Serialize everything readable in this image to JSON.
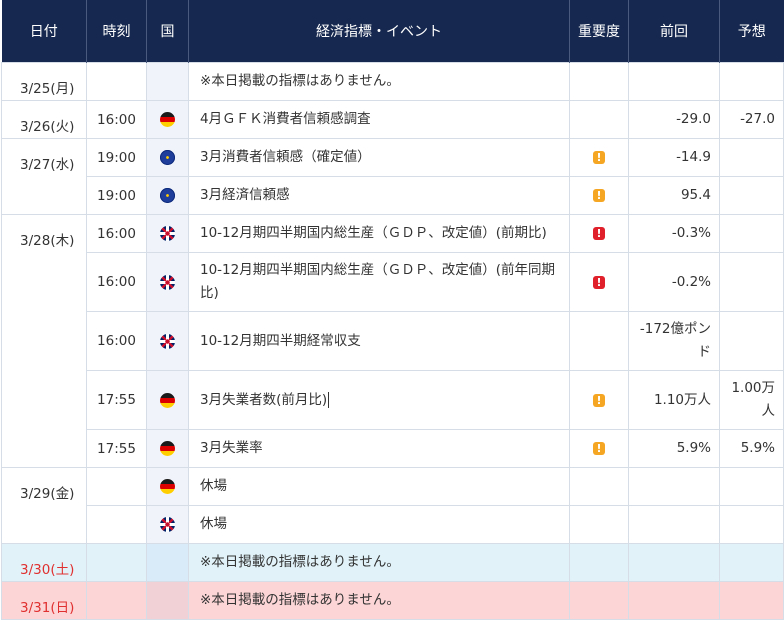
{
  "header": {
    "date": "日付",
    "time": "時刻",
    "country": "国",
    "event": "経済指標・イベント",
    "importance": "重要度",
    "previous": "前回",
    "forecast": "予想"
  },
  "rows": [
    {
      "date": "3/25(月)",
      "time": "",
      "flag": "",
      "event": "※本日掲載の指標はありません。",
      "importance": "",
      "previous": "",
      "forecast": ""
    },
    {
      "date": "3/26(火)",
      "time": "16:00",
      "flag": "germany-flag-icon",
      "event": "4月ＧＦＫ消費者信頼感調査",
      "importance": "",
      "previous": "-29.0",
      "forecast": "-27.0"
    },
    {
      "date": "3/27(水)",
      "time": "19:00",
      "flag": "eu-flag-icon",
      "event": "3月消費者信頼感（確定値）",
      "importance": "medium",
      "previous": "-14.9",
      "forecast": ""
    },
    {
      "date": "",
      "time": "19:00",
      "flag": "eu-flag-icon",
      "event": "3月経済信頼感",
      "importance": "medium",
      "previous": "95.4",
      "forecast": ""
    },
    {
      "date": "3/28(木)",
      "time": "16:00",
      "flag": "uk-flag-icon",
      "event": "10-12月期四半期国内総生産（ＧＤＰ、改定値）(前期比)",
      "importance": "high",
      "previous": "-0.3%",
      "forecast": ""
    },
    {
      "date": "",
      "time": "16:00",
      "flag": "uk-flag-icon",
      "event": "10-12月期四半期国内総生産（ＧＤＰ、改定値）(前年同期比)",
      "importance": "high",
      "previous": "-0.2%",
      "forecast": ""
    },
    {
      "date": "",
      "time": "16:00",
      "flag": "uk-flag-icon",
      "event": "10-12月期四半期経常収支",
      "importance": "",
      "previous": "-172億ポンド",
      "forecast": ""
    },
    {
      "date": "",
      "time": "17:55",
      "flag": "germany-flag-icon",
      "event": "3月失業者数(前月比)",
      "importance": "medium",
      "previous": "1.10万人",
      "forecast": "1.00万人"
    },
    {
      "date": "",
      "time": "17:55",
      "flag": "germany-flag-icon",
      "event": "3月失業率",
      "importance": "medium",
      "previous": "5.9%",
      "forecast": "5.9%"
    },
    {
      "date": "3/29(金)",
      "time": "",
      "flag": "germany-flag-icon",
      "event": "休場",
      "importance": "",
      "previous": "",
      "forecast": ""
    },
    {
      "date": "",
      "time": "",
      "flag": "uk-flag-icon",
      "event": "休場",
      "importance": "",
      "previous": "",
      "forecast": ""
    },
    {
      "date": "3/30(土)",
      "time": "",
      "flag": "",
      "event": "※本日掲載の指標はありません。",
      "importance": "",
      "previous": "",
      "forecast": ""
    },
    {
      "date": "3/31(日)",
      "time": "",
      "flag": "",
      "event": "※本日掲載の指標はありません。",
      "importance": "",
      "previous": "",
      "forecast": ""
    }
  ],
  "importance_badge": "!",
  "colors": {
    "header_bg": "#16284f",
    "weekend_sat_bg": "#e1f3f9",
    "weekend_sun_bg": "#fcd5d6",
    "weekend_date_text": "#e03030",
    "importance_medium": "#f5a623",
    "importance_high": "#e0202a"
  }
}
